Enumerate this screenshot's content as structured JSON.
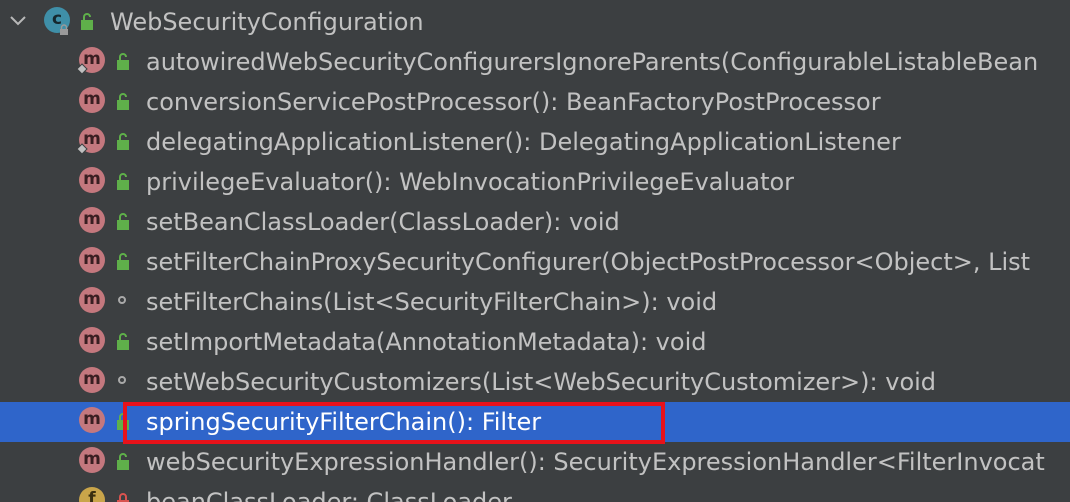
{
  "tree": {
    "root": {
      "name": "WebSecurityConfiguration",
      "kind_icon": "c-class-icon",
      "kind_letter": "c",
      "expanded": true
    },
    "items": [
      {
        "text": "autowiredWebSecurityConfigurersIgnoreParents(ConfigurableListableBean",
        "kind_letter": "m",
        "kind_icon": "method-icon",
        "visibility": "public",
        "bean": true,
        "selected": false
      },
      {
        "text": "conversionServicePostProcessor(): BeanFactoryPostProcessor",
        "kind_letter": "m",
        "kind_icon": "method-icon",
        "visibility": "public",
        "bean": false,
        "selected": false
      },
      {
        "text": "delegatingApplicationListener(): DelegatingApplicationListener",
        "kind_letter": "m",
        "kind_icon": "method-icon",
        "visibility": "public",
        "bean": true,
        "selected": false
      },
      {
        "text": "privilegeEvaluator(): WebInvocationPrivilegeEvaluator",
        "kind_letter": "m",
        "kind_icon": "method-icon",
        "visibility": "public",
        "bean": false,
        "selected": false
      },
      {
        "text": "setBeanClassLoader(ClassLoader): void",
        "kind_letter": "m",
        "kind_icon": "method-icon",
        "visibility": "public",
        "bean": false,
        "selected": false
      },
      {
        "text": "setFilterChainProxySecurityConfigurer(ObjectPostProcessor<Object>, List",
        "kind_letter": "m",
        "kind_icon": "method-icon",
        "visibility": "public",
        "bean": false,
        "selected": false
      },
      {
        "text": "setFilterChains(List<SecurityFilterChain>): void",
        "kind_letter": "m",
        "kind_icon": "method-icon",
        "visibility": "package",
        "bean": false,
        "selected": false
      },
      {
        "text": "setImportMetadata(AnnotationMetadata): void",
        "kind_letter": "m",
        "kind_icon": "method-icon",
        "visibility": "public",
        "bean": false,
        "selected": false
      },
      {
        "text": "setWebSecurityCustomizers(List<WebSecurityCustomizer>): void",
        "kind_letter": "m",
        "kind_icon": "method-icon",
        "visibility": "package",
        "bean": false,
        "selected": false
      },
      {
        "text": "springSecurityFilterChain(): Filter",
        "kind_letter": "m",
        "kind_icon": "method-icon",
        "visibility": "public",
        "bean": false,
        "selected": true
      },
      {
        "text": "webSecurityExpressionHandler(): SecurityExpressionHandler<FilterInvocat",
        "kind_letter": "m",
        "kind_icon": "method-icon",
        "visibility": "public",
        "bean": false,
        "selected": false
      },
      {
        "text": "beanClassLoader: ClassLoader",
        "kind_letter": "f",
        "kind_icon": "field-icon",
        "visibility": "private",
        "bean": false,
        "selected": false
      }
    ]
  },
  "colors": {
    "background": "#3c3f41",
    "selection": "#2f65ca",
    "highlight_border": "#e8121a",
    "method_badge": "#c4787e",
    "class_badge": "#3f8fa8",
    "field_badge": "#c9a54a",
    "public_lock": "#5fb04a",
    "private_lock": "#d9534f"
  }
}
